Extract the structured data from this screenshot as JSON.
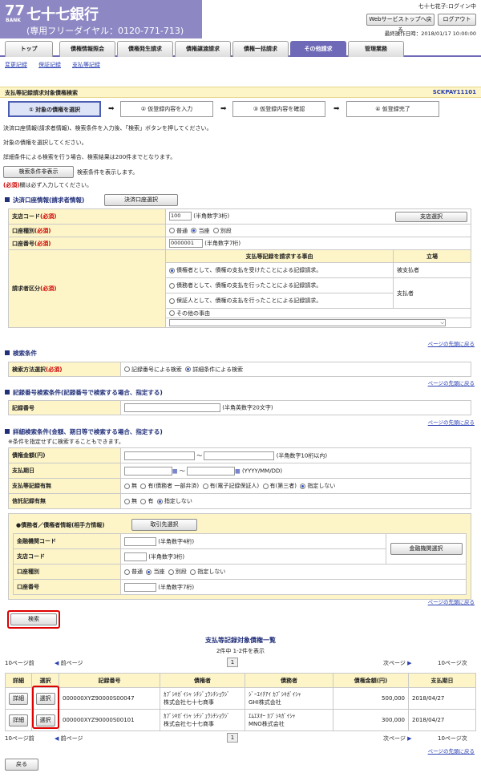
{
  "header": {
    "logo_num": "77",
    "logo_bank": "BANK",
    "bank_name": "七十七銀行",
    "free_dial": "(専用フリーダイヤル：0120-771-713)",
    "user": "七十七花子:ログイン中",
    "web_top": "Webサービストップへ戻る",
    "logout": "ログアウト",
    "last_op": "最終操作日時：2018/01/17 10:00:00"
  },
  "tabs": [
    "トップ",
    "債権情報照会",
    "債権発生請求",
    "債権譲渡請求",
    "債権一括請求",
    "その他請求",
    "管理業務"
  ],
  "subnav": [
    "変更記録",
    "保証記録",
    "支払等記録"
  ],
  "title": "支払等記録請求対象債権検索",
  "screen_code": "SCKPAY11101",
  "steps": [
    "① 対象の債権を選択",
    "② 仮登録内容を入力",
    "③ 仮登録内容を確認",
    "④ 仮登録完了"
  ],
  "intro": [
    "決済口座情報(請求者情報)、検索条件を入力後、「検索」ボタンを押してください。",
    "対象の債権を選択してください。",
    "詳細条件による検索を行う場合、検索結果は200件までとなります。"
  ],
  "toggle_btn": "検索条件非表示",
  "toggle_note": "検索条件を表示します。",
  "req_note_a": "(必須)",
  "req_note_b": "欄は必ず入力してください。",
  "acct": {
    "title": "決済口座情報(請求者情報)",
    "select_btn": "決済口座選択",
    "branch_lbl": "支店コード",
    "req": "(必須)",
    "branch_val": "100",
    "branch_hint": "(半角数字3桁)",
    "branch_btn": "支店選択",
    "type_lbl": "口座種別",
    "type_opts": [
      "普通",
      "当座",
      "別段"
    ],
    "num_lbl": "口座番号",
    "num_val": "0000001",
    "num_hint": "(半角数字7桁)",
    "reason_head": "支払等記録を請求する事由",
    "pos_head": "立場",
    "kubun_lbl": "請求者区分",
    "reasons": [
      "債権者として、債権の支払を受けたことによる記録請求。",
      "債務者として、債権の支払を行ったことによる記録請求。",
      "保証人として、債権の支払を行ったことによる記録請求。",
      "その他の事由"
    ],
    "pos1": "被支払者",
    "pos2": "支払者"
  },
  "pagetop": "ページの先頭に戻る",
  "cond": {
    "title": "検索条件",
    "method_lbl": "検索方法選択",
    "opt1": "記録番号による検索",
    "opt2": "詳細条件による検索"
  },
  "recno": {
    "title": "記録番号検索条件(記録番号で検索する場合、指定する)",
    "lbl": "記録番号",
    "hint": "(半角英数字20文字)"
  },
  "detail": {
    "title": "詳細検索条件(金額、期日等で検索する場合、指定する)",
    "note": "※条件を指定せずに検索することもできます。",
    "amount_lbl": "債権金額(円)",
    "tilde": "〜",
    "amount_hint": "(半角数字10桁以内)",
    "due_lbl": "支払期日",
    "due_hint": "(YYYY/MM/DD)",
    "pay_lbl": "支払等記録有無",
    "pay_opts": [
      "無",
      "有(債務者 一部弁済)",
      "有(電子記録保証人)",
      "有(第三者)",
      "指定しない"
    ],
    "trust_lbl": "信託記録有無",
    "trust_opts": [
      "無",
      "有",
      "指定しない"
    ],
    "party_title": "●債務者／債権者情報(相手方情報)",
    "party_btn": "取引先選択",
    "fin_lbl": "金融機関コード",
    "fin_hint": "(半角数字4桁)",
    "fin_btn": "金融機関選択",
    "br_lbl": "支店コード",
    "br_hint": "(半角数字3桁)",
    "type_lbl": "口座種別",
    "type_opts": [
      "普通",
      "当座",
      "別段",
      "指定しない"
    ],
    "num_lbl": "口座番号",
    "num_hint": "(半角数字7桁)"
  },
  "search_btn": "検索",
  "results": {
    "title": "支払等記録対象債権一覧",
    "count": "2件中 1-2件を表示",
    "prev10": "10ページ前",
    "prev": "前ページ",
    "page": "1",
    "next": "次ページ",
    "next10": "10ページ次",
    "headers": [
      "詳細",
      "選択",
      "記録番号",
      "債権者",
      "債務者",
      "債権金額(円)",
      "支払期日"
    ],
    "detail_btn": "詳細",
    "select_btn": "選択",
    "rows": [
      {
        "rec": "000000XYZ90000S00047",
        "cred1": "ｶﾌﾞｼｷｶﾞｲｼｬ ｼﾁｼﾞｭｳｼﾁｼｮｳｼﾞ",
        "cred2": "株式会社七十七商事",
        "debt1": "ｼﾞｰｴｲﾁｱｲ ｶﾌﾞｼｷｶﾞｲｼｬ",
        "debt2": "GHI株式会社",
        "amount": "500,000",
        "due": "2018/04/27"
      },
      {
        "rec": "000000XYZ90000S00101",
        "cred1": "ｶﾌﾞｼｷｶﾞｲｼｬ ｼﾁｼﾞｭｳｼﾁｼｮｳｼﾞ",
        "cred2": "株式会社七十七商事",
        "debt1": "ｴﾑｴﾇｵｰ ｶﾌﾞｼｷｶﾞｲｼｬ",
        "debt2": "MNO株式会社",
        "amount": "300,000",
        "due": "2018/04/27"
      }
    ]
  },
  "back_btn": "戻る"
}
